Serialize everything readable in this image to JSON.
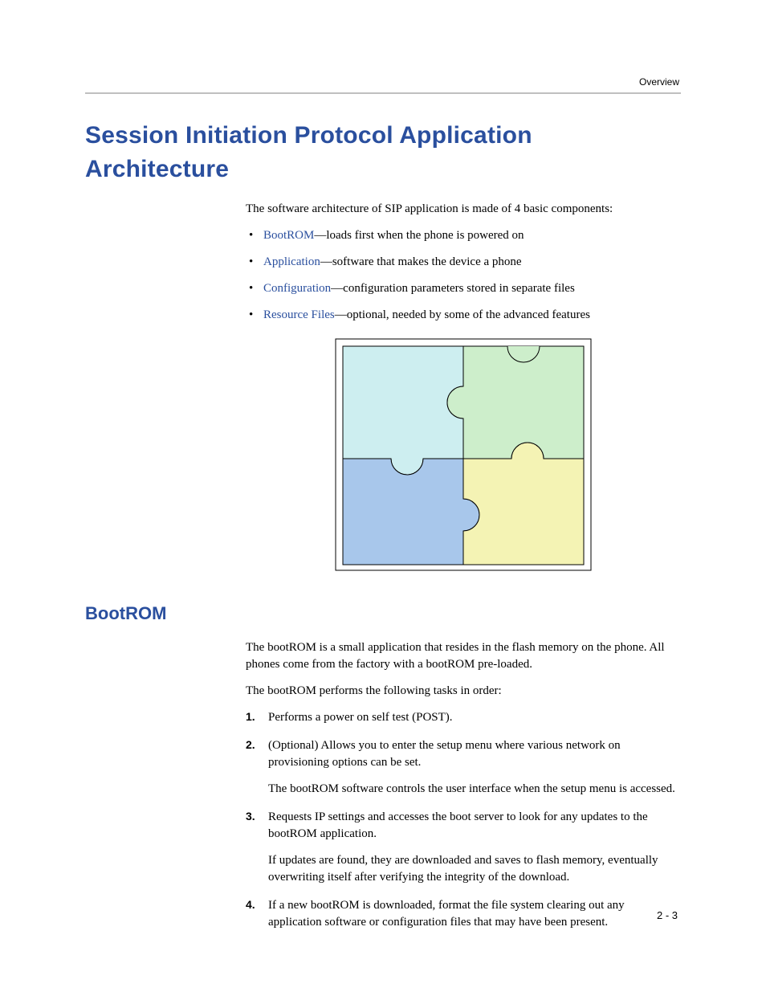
{
  "header": {
    "running_head": "Overview",
    "page_number": "2 - 3"
  },
  "section": {
    "title": "Session Initiation Protocol Application Architecture",
    "intro": "The software architecture of SIP application is made of 4 basic components:",
    "bullets": [
      {
        "link": "BootROM",
        "rest": "—loads first when the phone is powered on"
      },
      {
        "link": "Application",
        "rest": "—software that makes the device a phone"
      },
      {
        "link": "Configuration",
        "rest": "—configuration parameters stored in separate files"
      },
      {
        "link": "Resource Files",
        "rest": "—optional, needed by some of the advanced features"
      }
    ]
  },
  "subsection": {
    "title": "BootROM",
    "p1": "The bootROM is a small application that resides in the flash memory on the phone. All phones come from the factory with a bootROM pre-loaded.",
    "p2": "The bootROM performs the following tasks in order:",
    "steps": [
      {
        "num": "1.",
        "paras": [
          "Performs a power on self test (POST)."
        ]
      },
      {
        "num": "2.",
        "paras": [
          "(Optional) Allows you to enter the setup menu where various network on provisioning options can be set.",
          "The bootROM software controls the user interface when the setup menu is accessed."
        ]
      },
      {
        "num": "3.",
        "paras": [
          "Requests IP settings and accesses the boot server to look for any updates to the bootROM application.",
          "If updates are found, they are downloaded and saves to flash memory, eventually overwriting itself after verifying the integrity of the download."
        ]
      },
      {
        "num": "4.",
        "paras": [
          "If a new bootROM is downloaded, format the file system clearing out any application software or configuration files that may have been present."
        ]
      }
    ]
  },
  "figure": {
    "alt": "puzzle-diagram"
  }
}
